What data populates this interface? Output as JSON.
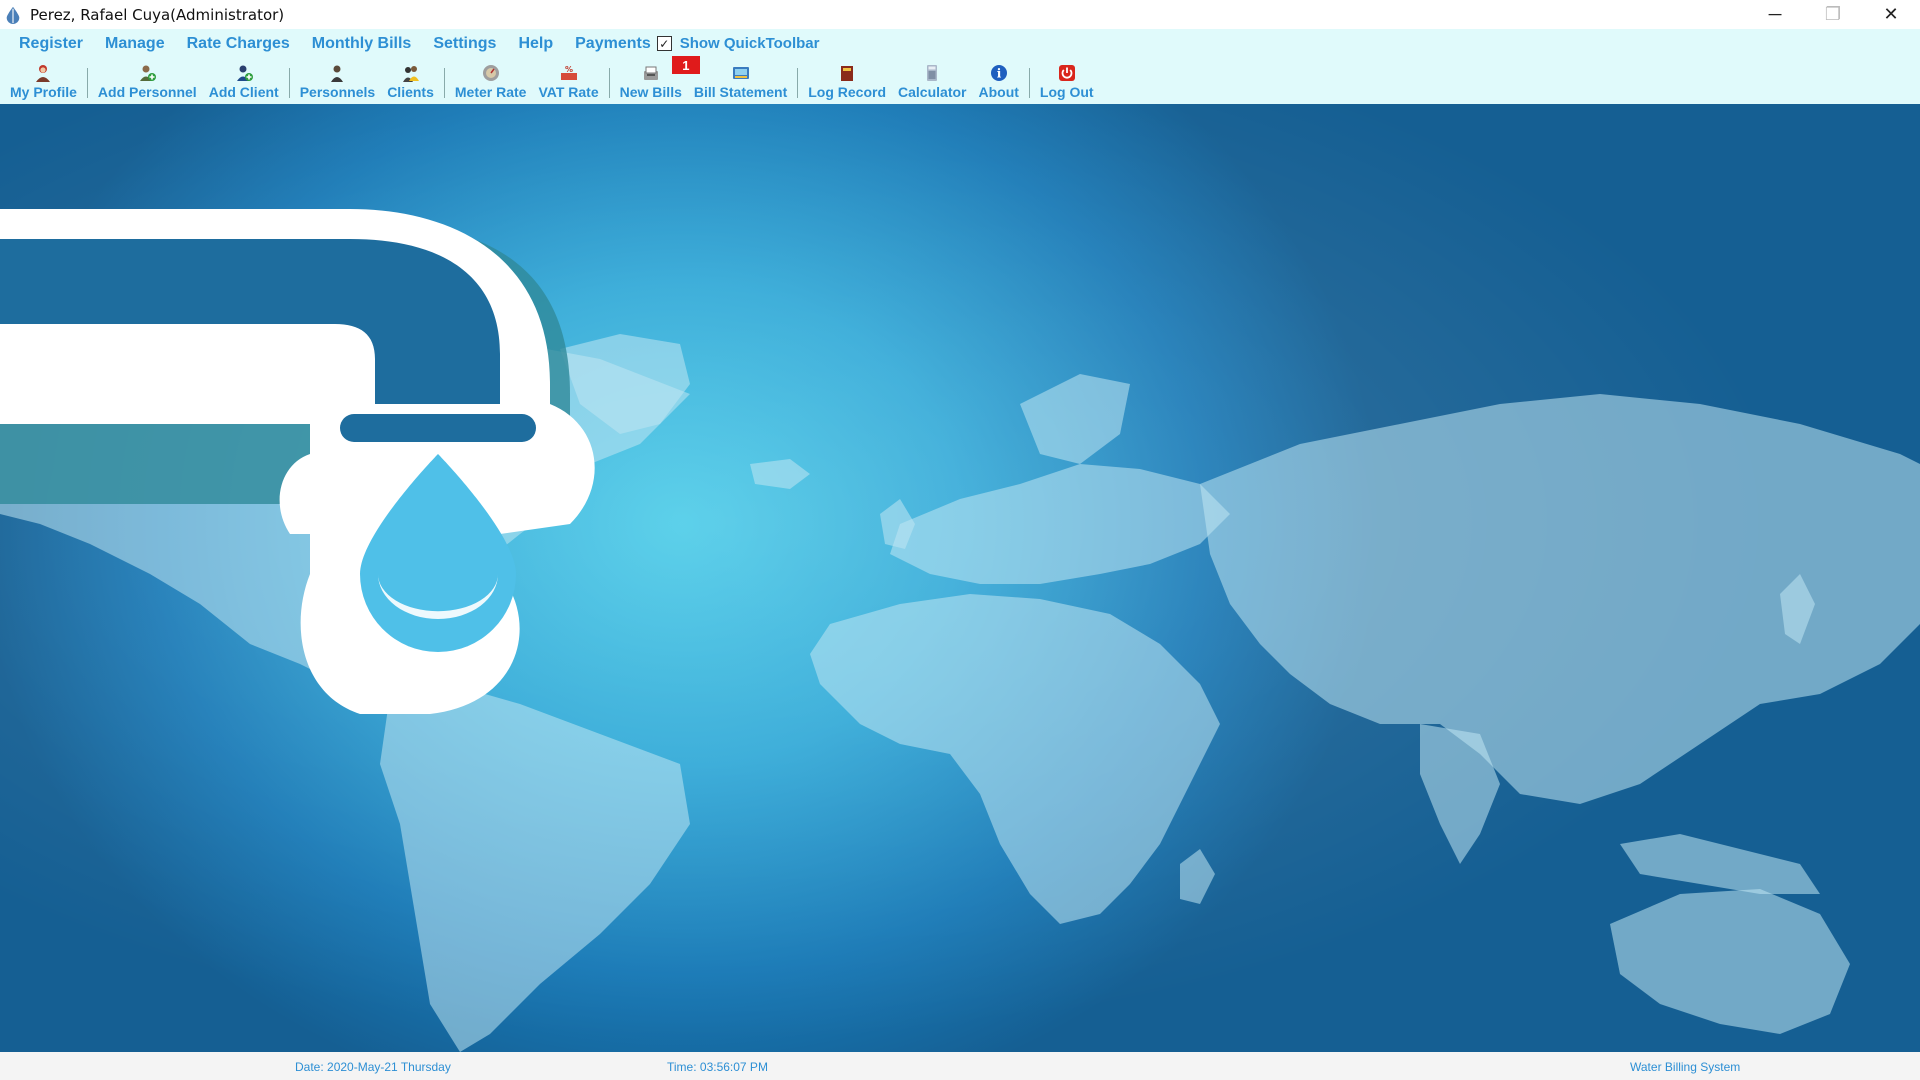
{
  "window": {
    "title": "Perez, Rafael Cuya(Administrator)",
    "controls": {
      "minimize": "─",
      "restore": "❐",
      "close": "✕"
    }
  },
  "menu": {
    "items": [
      "Register",
      "Manage",
      "Rate Charges",
      "Monthly Bills",
      "Settings",
      "Help",
      "Payments"
    ],
    "quick_toolbar": {
      "label": "Show QuickToolbar",
      "checked": true,
      "check_glyph": "✓"
    }
  },
  "toolbar": {
    "groups": [
      [
        {
          "label": "My Profile",
          "icon": "profile-icon"
        }
      ],
      [
        {
          "label": "Add Personnel",
          "icon": "add-personnel-icon"
        },
        {
          "label": "Add Client",
          "icon": "add-client-icon"
        }
      ],
      [
        {
          "label": "Personnels",
          "icon": "personnels-icon"
        },
        {
          "label": "Clients",
          "icon": "clients-icon"
        }
      ],
      [
        {
          "label": "Meter Rate",
          "icon": "meter-icon"
        },
        {
          "label": "VAT Rate",
          "icon": "vat-icon"
        }
      ],
      [
        {
          "label": "New Bills",
          "icon": "new-bills-icon",
          "badge": "1"
        },
        {
          "label": "Bill Statement",
          "icon": "bill-statement-icon"
        }
      ],
      [
        {
          "label": "Log Record",
          "icon": "log-record-icon"
        },
        {
          "label": "Calculator",
          "icon": "calculator-icon"
        },
        {
          "label": "About",
          "icon": "about-icon"
        }
      ],
      [
        {
          "label": "Log Out",
          "icon": "power-icon"
        }
      ]
    ]
  },
  "statusbar": {
    "date": "Date: 2020-May-21 Thursday",
    "time": "Time: 03:56:07 PM",
    "app": "Water Billing System"
  },
  "colors": {
    "accent": "#2d8fd4",
    "menu_bg": "#e0fafb",
    "badge": "#e01b1b",
    "background_light": "#3bc7e6",
    "background_dark": "#155f93"
  }
}
